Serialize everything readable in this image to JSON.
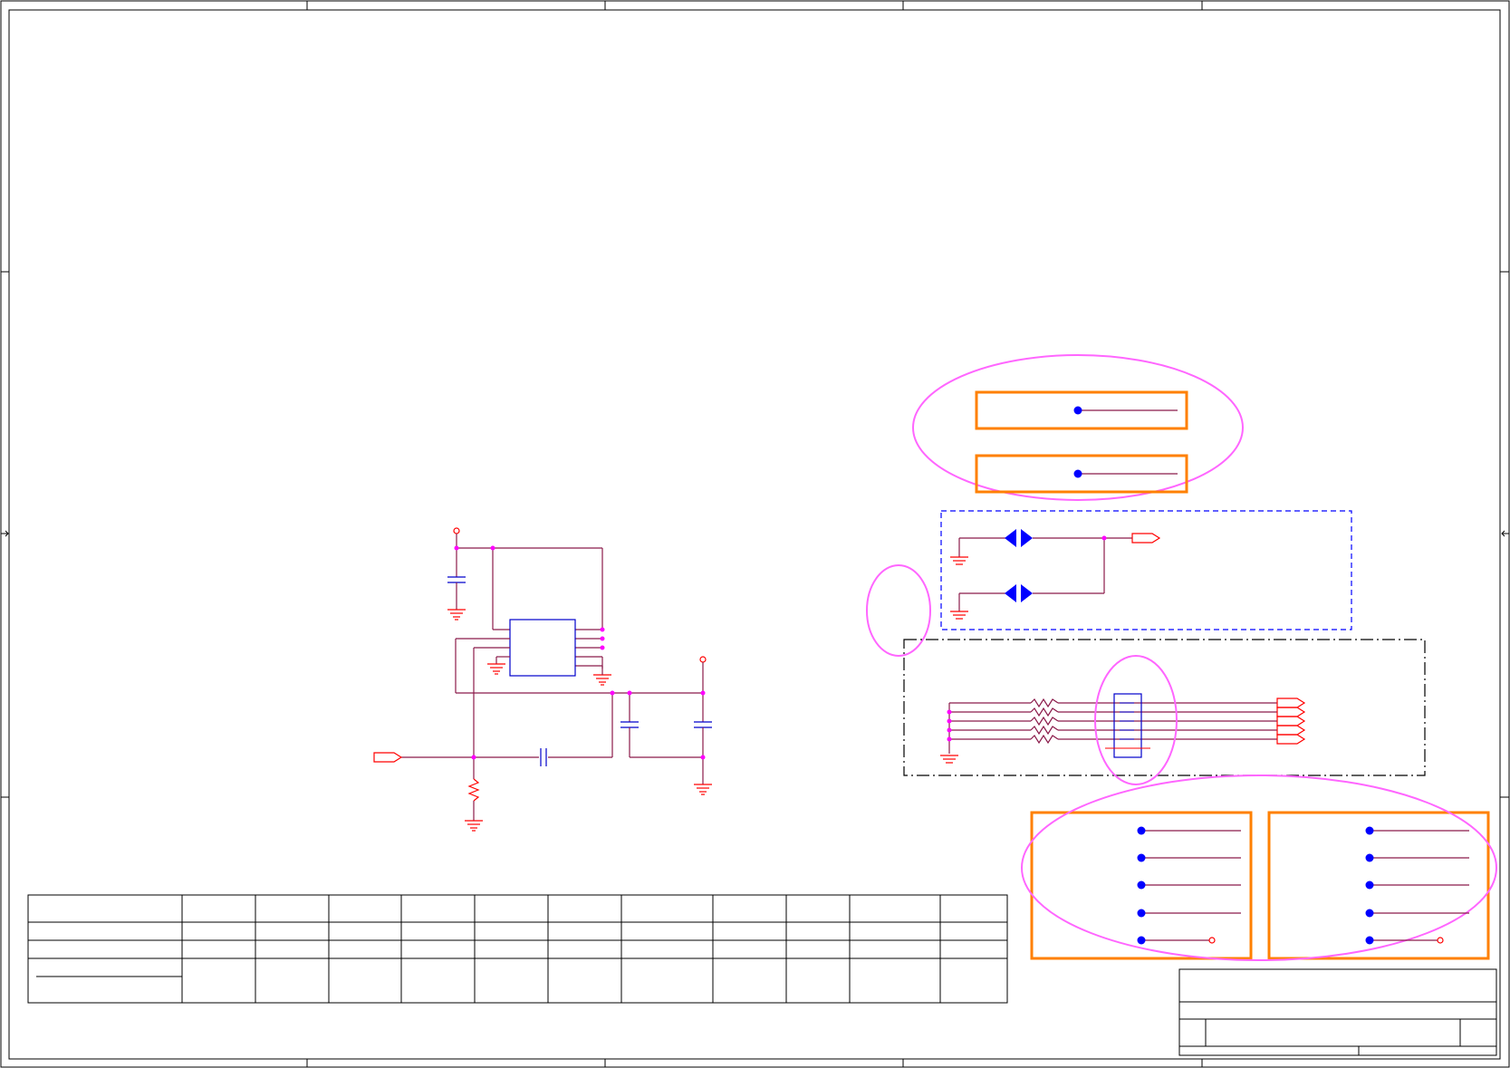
{
  "colors": {
    "background": "#ffffff",
    "frame": "#000000",
    "wire": "#8b1a4a",
    "junction": "#ff00ff",
    "component": "#0000cc",
    "port": "#ff0000",
    "highlight_box": "#ff8000",
    "highlight_ellipse": "#ff66ff",
    "group_dashed": "#0000ff"
  },
  "icons": {
    "ground": "ground-icon",
    "power": "power-port-icon",
    "resistor": "resistor-icon",
    "capacitor": "capacitor-icon",
    "ic": "ic-chip-icon",
    "diode_pair": "tvs-diode-pair-icon",
    "offsheet_port": "offsheet-port-icon",
    "connector": "connector-icon"
  },
  "table": {
    "rows": 4,
    "columns": 13,
    "cells_text": []
  },
  "title_block": {
    "text": []
  }
}
